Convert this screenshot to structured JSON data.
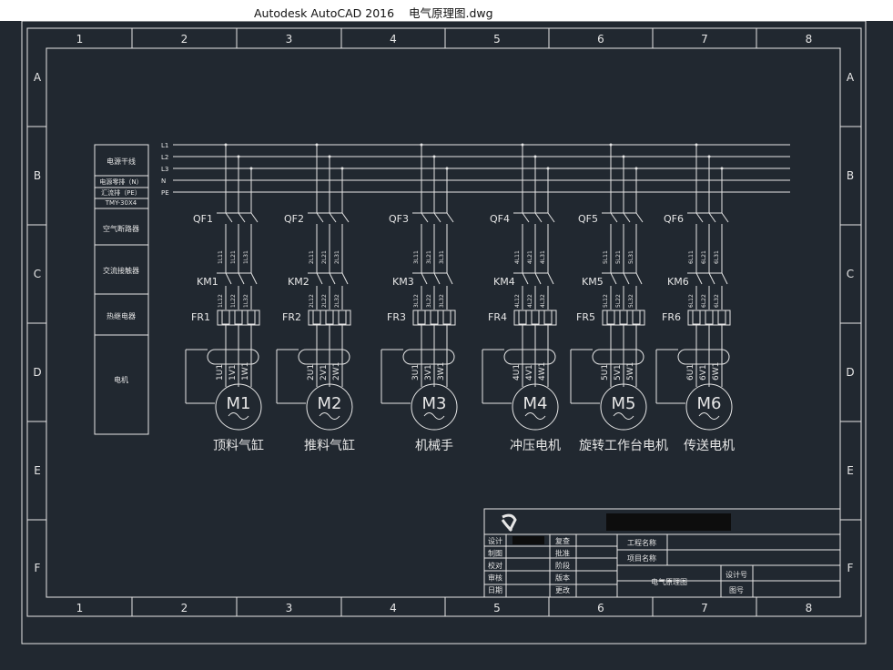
{
  "window": {
    "title": "Autodesk AutoCAD 2016    电气原理图.dwg"
  },
  "frame": {
    "columns": [
      "1",
      "2",
      "3",
      "4",
      "5",
      "6",
      "7",
      "8"
    ],
    "rows": [
      "A",
      "B",
      "C",
      "D",
      "E",
      "F"
    ]
  },
  "legend": [
    "电源干线",
    "电源零排（N）",
    "汇流排（PE）",
    "TMY-30X4",
    "空气断路器",
    "交流接触器",
    "热继电器",
    "电机"
  ],
  "bus_labels": [
    "L1",
    "L2",
    "L3",
    "N",
    "PE"
  ],
  "circuits": [
    {
      "qf": "QF1",
      "km": "KM1",
      "fr": "FR1",
      "motor": "M1",
      "name": "顶料气缸",
      "t1": [
        "1L11",
        "1L21",
        "1L31"
      ],
      "t2": [
        "1L12",
        "1L22",
        "1L32"
      ],
      "t3": [
        "1U1",
        "1V1",
        "1W1"
      ]
    },
    {
      "qf": "QF2",
      "km": "KM2",
      "fr": "FR2",
      "motor": "M2",
      "name": "推料气缸",
      "t1": [
        "2L11",
        "2L21",
        "2L31"
      ],
      "t2": [
        "2L12",
        "2L22",
        "2L32"
      ],
      "t3": [
        "2U1",
        "2V1",
        "2W1"
      ]
    },
    {
      "qf": "QF3",
      "km": "KM3",
      "fr": "FR3",
      "motor": "M3",
      "name": "机械手",
      "t1": [
        "3L11",
        "3L21",
        "3L31"
      ],
      "t2": [
        "3L12",
        "3L22",
        "3L32"
      ],
      "t3": [
        "3U1",
        "3V1",
        "3W1"
      ]
    },
    {
      "qf": "QF4",
      "km": "KM4",
      "fr": "FR4",
      "motor": "M4",
      "name": "冲压电机",
      "t1": [
        "4L11",
        "4L21",
        "4L31"
      ],
      "t2": [
        "4L12",
        "4L22",
        "4L32"
      ],
      "t3": [
        "4U1",
        "4V1",
        "4W1"
      ]
    },
    {
      "qf": "QF5",
      "km": "KM5",
      "fr": "FR5",
      "motor": "M5",
      "name": "旋转工作台电机",
      "t1": [
        "5L11",
        "5L21",
        "5L31"
      ],
      "t2": [
        "5L12",
        "5L22",
        "5L32"
      ],
      "t3": [
        "5U1",
        "5V1",
        "5W1"
      ]
    },
    {
      "qf": "QF6",
      "km": "KM6",
      "fr": "FR6",
      "motor": "M6",
      "name": "传送电机",
      "t1": [
        "6L11",
        "6L21",
        "6L31"
      ],
      "t2": [
        "6L12",
        "6L22",
        "6L32"
      ],
      "t3": [
        "6U1",
        "6V1",
        "6W1"
      ]
    }
  ],
  "title_block": {
    "left_labels": [
      "设计",
      "制图",
      "校对",
      "审核",
      "日期"
    ],
    "mid_labels": [
      "复查",
      "批准",
      "阶段",
      "版本",
      "更改"
    ],
    "project_labels": [
      "工程名称",
      "项目名称"
    ],
    "drawing_title": "电气原理图",
    "design_no": "设计号",
    "drawing_no": "图号"
  },
  "colors": {
    "background": "#212830",
    "line": "#e6e6e6",
    "redacted": "#0d0d0d"
  }
}
